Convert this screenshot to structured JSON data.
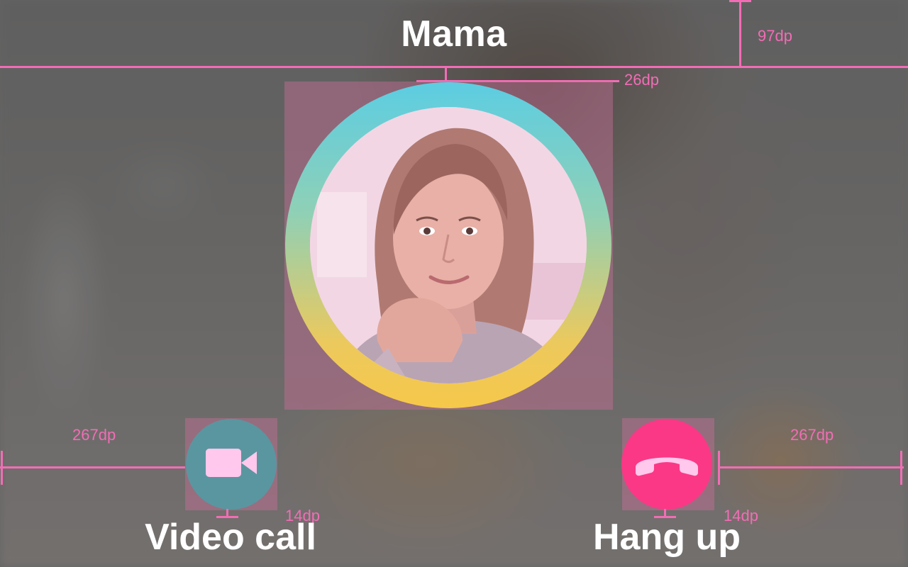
{
  "contact": {
    "name": "Mama"
  },
  "actions": {
    "video_call_label": "Video call",
    "hang_up_label": "Hang up"
  },
  "measurements": {
    "top_margin": "97dp",
    "avatar_gap": "26dp",
    "left_margin": "267dp",
    "right_margin": "267dp",
    "video_label_gap": "14dp",
    "hang_label_gap": "14dp"
  },
  "icons": {
    "video": "video-camera-icon",
    "hang": "phone-hangup-icon"
  },
  "colors": {
    "guide": "#f26db5",
    "video_button": "#5a96a0",
    "hang_button": "#fb3886",
    "ring_top": "#5ccde2",
    "ring_bottom": "#f6c84a"
  }
}
